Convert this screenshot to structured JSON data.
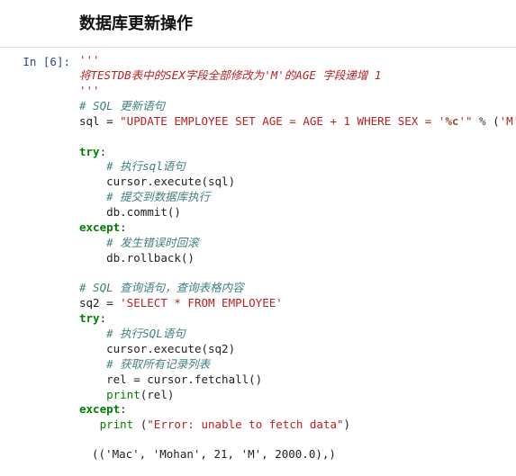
{
  "header": {
    "title": "数据库更新操作"
  },
  "cell": {
    "prompt": "In [6]:",
    "code": {
      "doc_open": "'''",
      "doc_body": "将TESTDB表中的SEX字段全部修改为'M'的AGE 字段递增 1",
      "doc_close": "'''",
      "c1": "# SQL 更新语句",
      "assign1_lhs": "sql = ",
      "sql1_p1": "\"UPDATE EMPLOYEE SET AGE = AGE + 1 WHERE SEX = '",
      "sql1_fmt": "%c",
      "sql1_p2": "'\"",
      "pct": " % ",
      "tuple1_open": "(",
      "tuple1_arg": "'M'",
      "tuple1_close": ")",
      "try1": "try",
      "colon": ":",
      "c2": "# 执行sql语句",
      "exec1": "cursor.execute(sql)",
      "c3": "# 提交到数据库执行",
      "commit": "db.commit()",
      "except1": "except",
      "c4": "# 发生错误时回滚",
      "rollback": "db.rollback()",
      "c5": "# SQL 查询语句，查询表格内容",
      "assign2_lhs": "sq2 = ",
      "sql2": "'SELECT * FROM EMPLOYEE'",
      "try2": "try",
      "c6": "# 执行SQL语句",
      "exec2": "cursor.execute(sq2)",
      "c7": "# 获取所有记录列表",
      "fetch": "rel = cursor.fetchall()",
      "print_kw": "print",
      "print_arg1": "(rel)",
      "except2": "except",
      "print2_open": " (",
      "err_str": "\"Error: unable to fetch data\"",
      "print2_close": ")"
    },
    "output": "(('Mac', 'Mohan', 21, 'M', 2000.0),)"
  }
}
